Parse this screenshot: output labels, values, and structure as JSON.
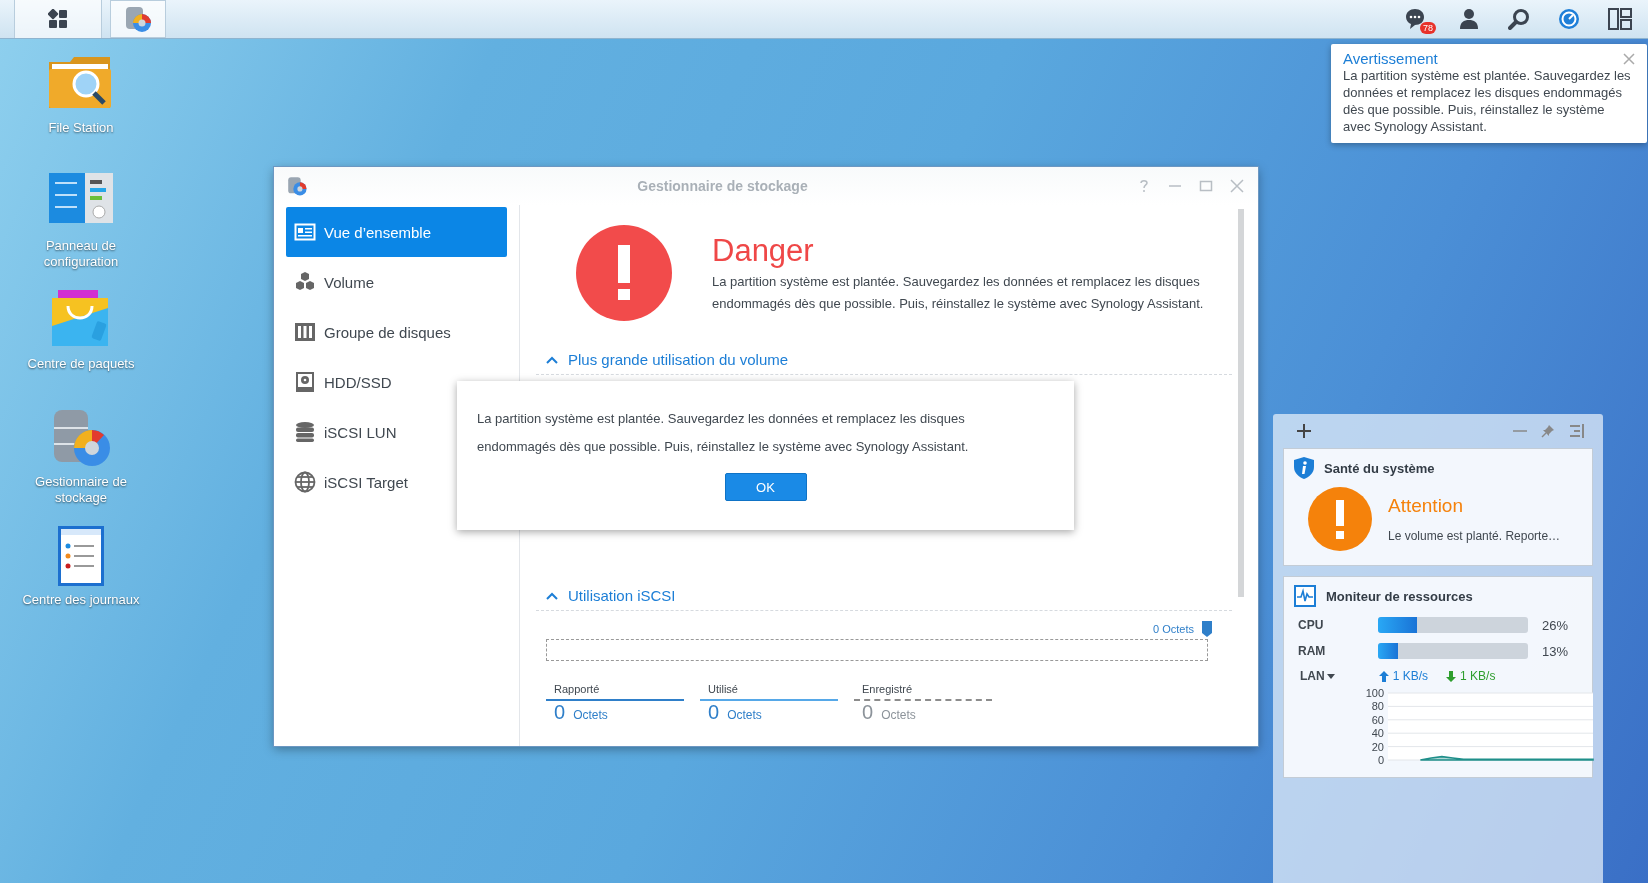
{
  "taskbar": {
    "notification_count": "78"
  },
  "desktop_icons": [
    {
      "label": "File Station",
      "kind": "folder"
    },
    {
      "label": "Panneau de configuration",
      "kind": "control"
    },
    {
      "label": "Centre de paquets",
      "kind": "package"
    },
    {
      "label": "Gestionnaire de stockage",
      "kind": "storage"
    },
    {
      "label": "Centre des journaux",
      "kind": "log"
    }
  ],
  "notification": {
    "title": "Avertissement",
    "message": "La partition système est plantée. Sauvegardez les données et remplacez les disques endommagés dès que possible. Puis, réinstallez le système avec Synology Assistant."
  },
  "window": {
    "title": "Gestionnaire de stockage",
    "sidebar": [
      {
        "label": "Vue d’ensemble",
        "kind": "overview",
        "selected": true
      },
      {
        "label": "Volume",
        "kind": "volume",
        "selected": false
      },
      {
        "label": "Groupe de disques",
        "kind": "diskgroup",
        "selected": false
      },
      {
        "label": "HDD/SSD",
        "kind": "hdd",
        "selected": false
      },
      {
        "label": "iSCSI LUN",
        "kind": "lun",
        "selected": false
      },
      {
        "label": "iSCSI Target",
        "kind": "target",
        "selected": false
      }
    ],
    "status": {
      "title": "Danger",
      "message": "La partition système est plantée. Sauvegardez les données et remplacez les disques endommagés dès que possible. Puis, réinstallez le système avec Synology Assistant."
    },
    "volume_section": {
      "title": "Plus grande utilisation du volume"
    },
    "iscsi_section": {
      "title": "Utilisation iSCSI",
      "capacity": "0 Octets",
      "stats": [
        {
          "label": "Rapporté",
          "value": "0",
          "unit": "Octets",
          "kind": "solid",
          "color": "#2f7fc9"
        },
        {
          "label": "Utilisé",
          "value": "0",
          "unit": "Octets",
          "kind": "solid",
          "color": "#56a8e8"
        },
        {
          "label": "Enregistré",
          "value": "0",
          "unit": "Octets",
          "kind": "dashed",
          "color": "#8c8c8c"
        }
      ]
    }
  },
  "dialog": {
    "message": "La partition système est plantée. Sauvegardez les données et remplacez les disques endommagés dès que possible. Puis, réinstallez le système avec Synology Assistant.",
    "button": "OK"
  },
  "widgets": {
    "health": {
      "title": "Santé du système",
      "status": "Attention",
      "message": "Le volume est planté. Reporte…"
    },
    "resource_monitor": {
      "title": "Moniteur de ressources",
      "meters": [
        {
          "label": "CPU",
          "level": 0.26,
          "reading": "26%"
        },
        {
          "label": "RAM",
          "level": 0.13,
          "reading": "13%"
        }
      ],
      "lan": {
        "label": "LAN",
        "upload": "1 KB/s",
        "download": "1 KB/s"
      },
      "chart_data": {
        "type": "area",
        "grid": true,
        "ylim": [
          0,
          100
        ],
        "yticks": [
          0,
          20,
          40,
          60,
          80,
          100
        ],
        "series": [
          {
            "color": "#1f8f8a",
            "values": [
              null,
              null,
              null,
              0,
              3,
              5,
              3,
              1,
              1,
              1,
              1,
              1,
              1,
              1,
              1,
              1,
              1,
              1,
              1,
              1
            ]
          }
        ]
      }
    }
  }
}
